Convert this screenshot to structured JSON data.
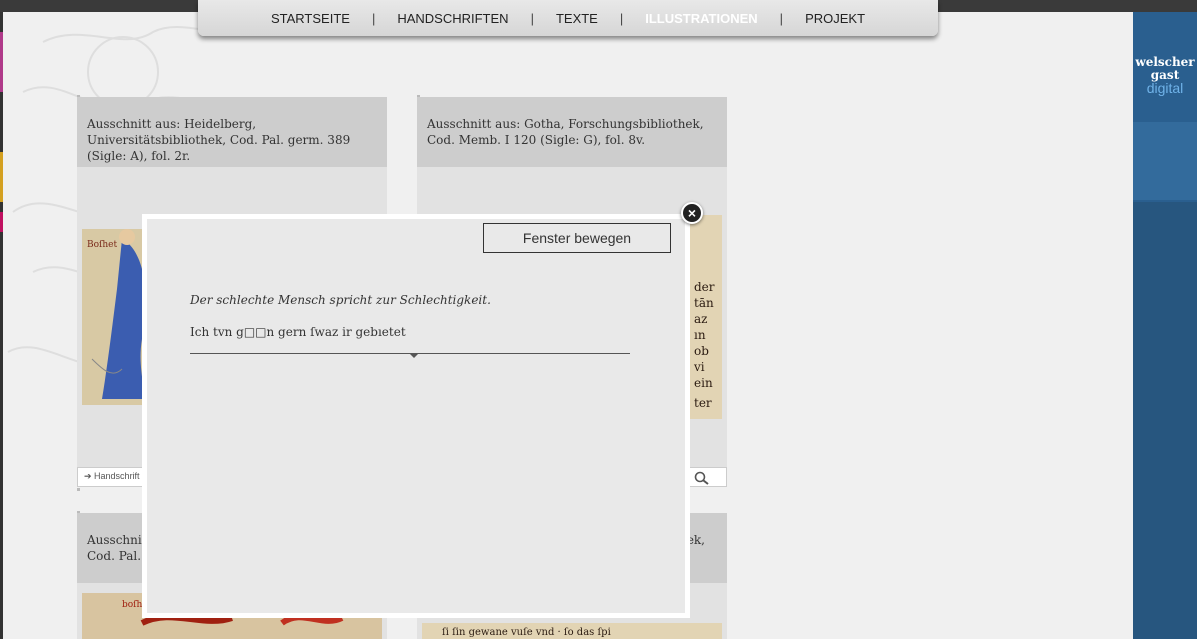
{
  "nav": {
    "items": [
      {
        "label": "STARTSEITE",
        "active": false
      },
      {
        "label": "HANDSCHRIFTEN",
        "active": false
      },
      {
        "label": "TEXTE",
        "active": false
      },
      {
        "label": "ILLUSTRATIONEN",
        "active": true
      },
      {
        "label": "PROJEKT",
        "active": false
      }
    ],
    "separator": "|"
  },
  "logo": {
    "line1": "welscher",
    "line2": "gast",
    "line3": "digital"
  },
  "cards": [
    {
      "caption": "Ausschnitt aus: Heidelberg, Universitätsbibliothek, Cod. Pal. germ. 389 (Sigle: A), fol. 2r.",
      "footer": "➔ Handschrift"
    },
    {
      "caption": "Ausschnitt aus: Gotha, Forschungsbibliothek, Cod. Memb. I 120 (Sigle: G), fol. 8v.",
      "footer": ""
    },
    {
      "caption": "Ausschnitt\nCod. Pal. g",
      "footer": ""
    },
    {
      "caption": "ek,",
      "footer": ""
    }
  ],
  "modal": {
    "move_label": "Fenster bewegen",
    "close_glyph": "×",
    "title": "Der schlechte Mensch spricht zur Schlechtigkeit.",
    "verse": "Ich tvn g□□n gern ſwaz ir gebıetet"
  },
  "colors": {
    "accent": "#2a5f8f",
    "nav_active": "#ffffff",
    "modal_bg": "#e9e9e9"
  }
}
